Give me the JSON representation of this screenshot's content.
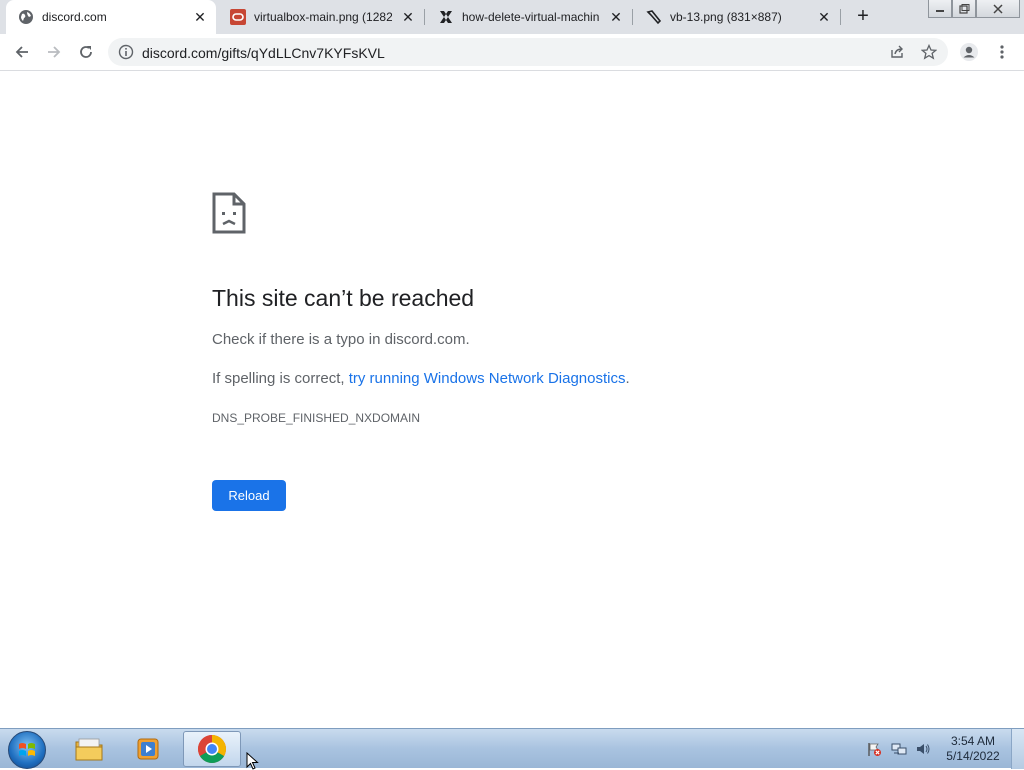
{
  "browser": {
    "tabs": [
      {
        "title": "discord.com",
        "icon": "globe-icon",
        "active": true
      },
      {
        "title": "virtualbox-main.png (1282",
        "icon": "oracle-icon",
        "active": false
      },
      {
        "title": "how-delete-virtual-machin",
        "icon": "x-site-icon",
        "active": false
      },
      {
        "title": "vb-13.png (831×887)",
        "icon": "tool-icon",
        "active": false
      }
    ],
    "new_tab": "+",
    "address": "discord.com/gifts/qYdLLCnv7KYFsKVL"
  },
  "error": {
    "title": "This site can’t be reached",
    "line1": "Check if there is a typo in discord.com.",
    "line2_prefix": "If spelling is correct, ",
    "line2_link": "try running Windows Network Diagnostics",
    "line2_suffix": ".",
    "code": "DNS_PROBE_FINISHED_NXDOMAIN",
    "reload_label": "Reload"
  },
  "taskbar": {
    "items": [
      "file-explorer-icon",
      "media-player-icon",
      "chrome-icon"
    ],
    "clock_time": "3:54 AM",
    "clock_date": "5/14/2022"
  },
  "colors": {
    "accent": "#1a73e8",
    "tabstrip": "#dee1e6",
    "text": "#202124",
    "muted": "#5f6368"
  }
}
